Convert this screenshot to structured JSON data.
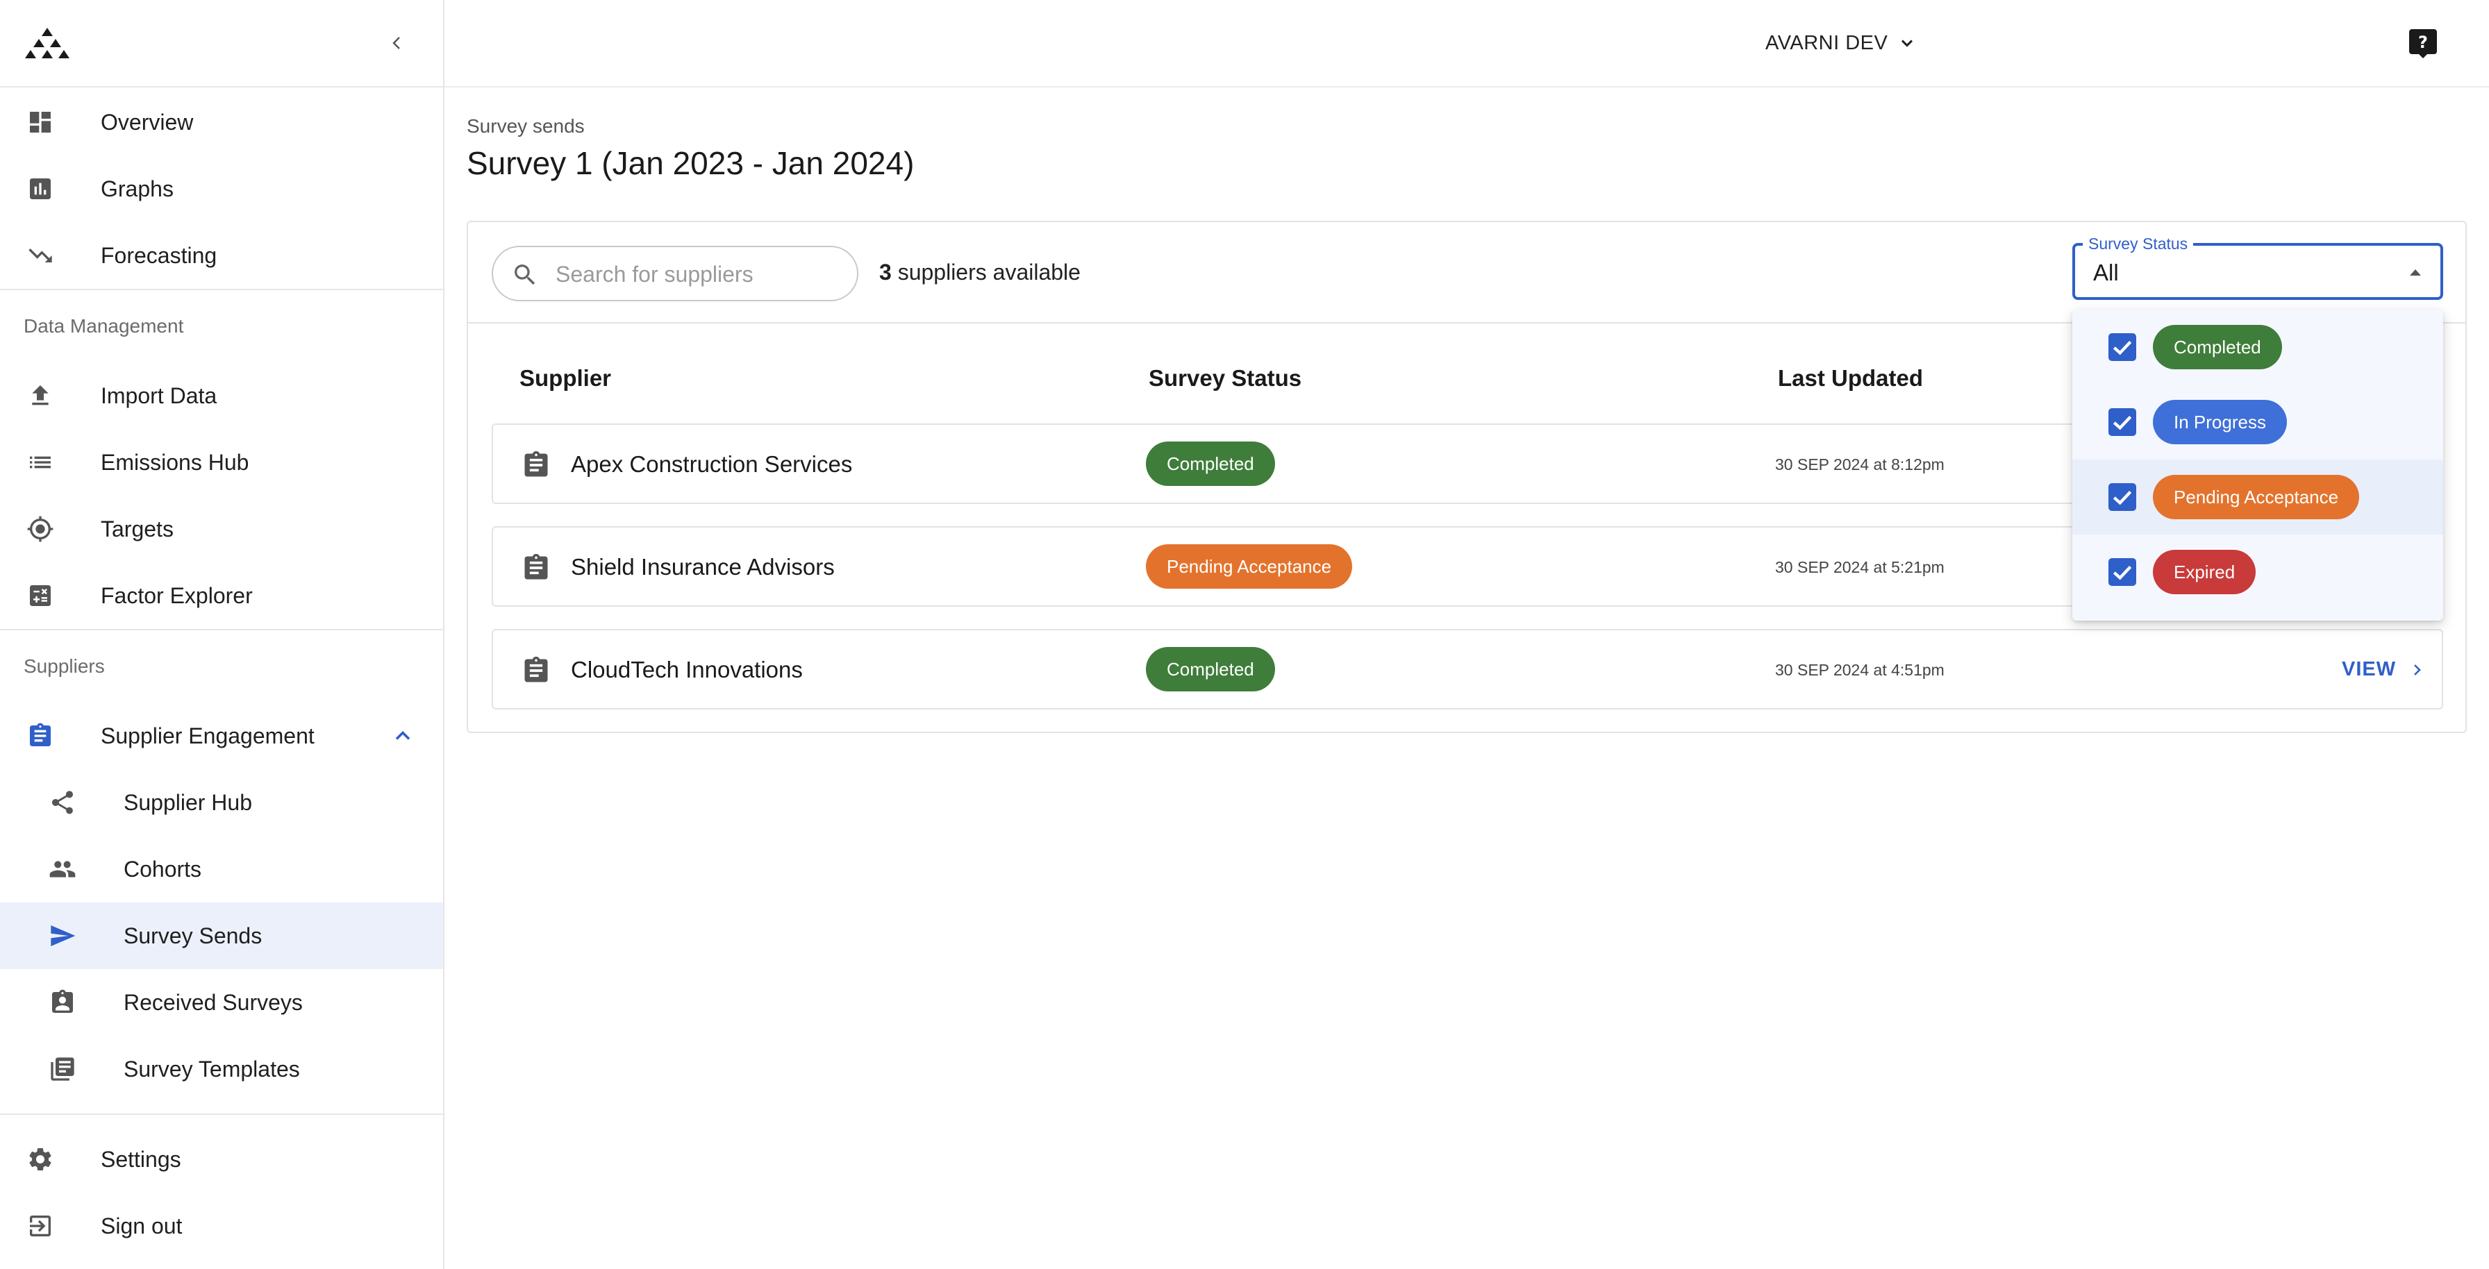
{
  "app": {
    "org_name": "AVARNI DEV"
  },
  "sidebar": {
    "primary": [
      {
        "label": "Overview",
        "icon": "dashboard-icon"
      },
      {
        "label": "Graphs",
        "icon": "bar-chart-icon"
      },
      {
        "label": "Forecasting",
        "icon": "trending-down-icon"
      }
    ],
    "data_management": {
      "title": "Data Management",
      "items": [
        {
          "label": "Import Data",
          "icon": "upload-icon"
        },
        {
          "label": "Emissions Hub",
          "icon": "list-icon"
        },
        {
          "label": "Targets",
          "icon": "target-icon"
        },
        {
          "label": "Factor Explorer",
          "icon": "calculator-icon"
        }
      ]
    },
    "suppliers": {
      "title": "Suppliers",
      "group_label": "Supplier Engagement",
      "items": [
        {
          "label": "Supplier Hub",
          "icon": "share-icon"
        },
        {
          "label": "Cohorts",
          "icon": "people-icon"
        },
        {
          "label": "Survey Sends",
          "icon": "send-icon",
          "active": true
        },
        {
          "label": "Received Surveys",
          "icon": "assignment-ind-icon"
        },
        {
          "label": "Survey Templates",
          "icon": "library-books-icon"
        }
      ]
    },
    "footer": [
      {
        "label": "Settings",
        "icon": "gear-icon"
      },
      {
        "label": "Sign out",
        "icon": "sign-out-icon"
      }
    ]
  },
  "main": {
    "breadcrumb": "Survey sends",
    "title": "Survey 1 (Jan 2023 - Jan 2024)",
    "search_placeholder": "Search for suppliers",
    "available_count": "3",
    "available_suffix": " suppliers available",
    "columns": {
      "supplier": "Supplier",
      "status": "Survey Status",
      "updated": "Last Updated"
    },
    "rows": [
      {
        "name": "Apex Construction Services",
        "status": "Completed",
        "updated": "30 SEP 2024 at 8:12pm"
      },
      {
        "name": "Shield Insurance Advisors",
        "status": "Pending Acceptance",
        "updated": "30 SEP 2024 at 5:21pm"
      },
      {
        "name": "CloudTech Innovations",
        "status": "Completed",
        "updated": "30 SEP 2024 at 4:51pm",
        "action": "VIEW"
      }
    ]
  },
  "filter": {
    "label": "Survey Status",
    "value": "All",
    "options": [
      {
        "label": "Completed",
        "checked": true
      },
      {
        "label": "In Progress",
        "checked": true
      },
      {
        "label": "Pending Acceptance",
        "checked": true
      },
      {
        "label": "Expired",
        "checked": true
      }
    ]
  },
  "colors": {
    "accent": "#2f5fc9",
    "completed": "#3e7d3a",
    "in_progress": "#3f6fd8",
    "pending": "#e3732c",
    "expired": "#c93a3a",
    "active_nav_bg": "#ecf0fb"
  }
}
